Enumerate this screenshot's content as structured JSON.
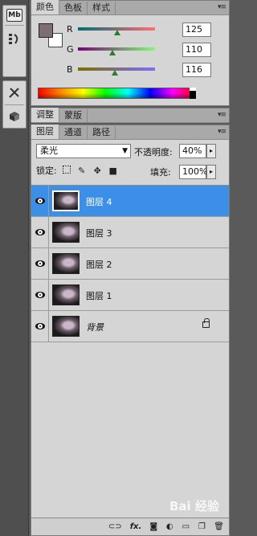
{
  "color_panel": {
    "tabs": [
      "颜色",
      "色板",
      "样式"
    ],
    "channels": [
      {
        "label": "R",
        "value": "125",
        "fraction": 0.49,
        "track": "linear-gradient(to right, #006e74, #ff6e74)"
      },
      {
        "label": "G",
        "value": "110",
        "fraction": 0.43,
        "track": "linear-gradient(to right, #7d0074, #7dff74)"
      },
      {
        "label": "B",
        "value": "116",
        "fraction": 0.45,
        "track": "linear-gradient(to right, #7d6e00, #7d6eff)"
      }
    ],
    "foreground_color": "#7d6e74",
    "background_color": "#ffffff"
  },
  "adjust_panel": {
    "tabs": [
      "调整",
      "蒙版"
    ]
  },
  "layers_panel": {
    "tabs": [
      "图层",
      "通道",
      "路径"
    ],
    "blend_mode": "柔光",
    "opacity_label": "不透明度:",
    "opacity_value": "40%",
    "lock_label": "锁定:",
    "fill_label": "填充:",
    "fill_value": "100%",
    "layers": [
      {
        "name": "图层 4",
        "selected": true,
        "locked": false,
        "italic": false
      },
      {
        "name": "图层 3",
        "selected": false,
        "locked": false,
        "italic": false
      },
      {
        "name": "图层 2",
        "selected": false,
        "locked": false,
        "italic": false
      },
      {
        "name": "图层 1",
        "selected": false,
        "locked": false,
        "italic": false
      },
      {
        "name": "背景",
        "selected": false,
        "locked": true,
        "italic": true
      }
    ],
    "bottom_buttons": [
      "link-icon",
      "fx-icon",
      "mask-icon",
      "adjustment-icon",
      "folder-icon",
      "new-layer-icon",
      "trash-icon"
    ],
    "fx_label": "fx."
  },
  "tools": [
    "mini-bridge-icon",
    "history-icon",
    "tools-icon",
    "3d-icon"
  ],
  "watermark": "Bai 经验"
}
